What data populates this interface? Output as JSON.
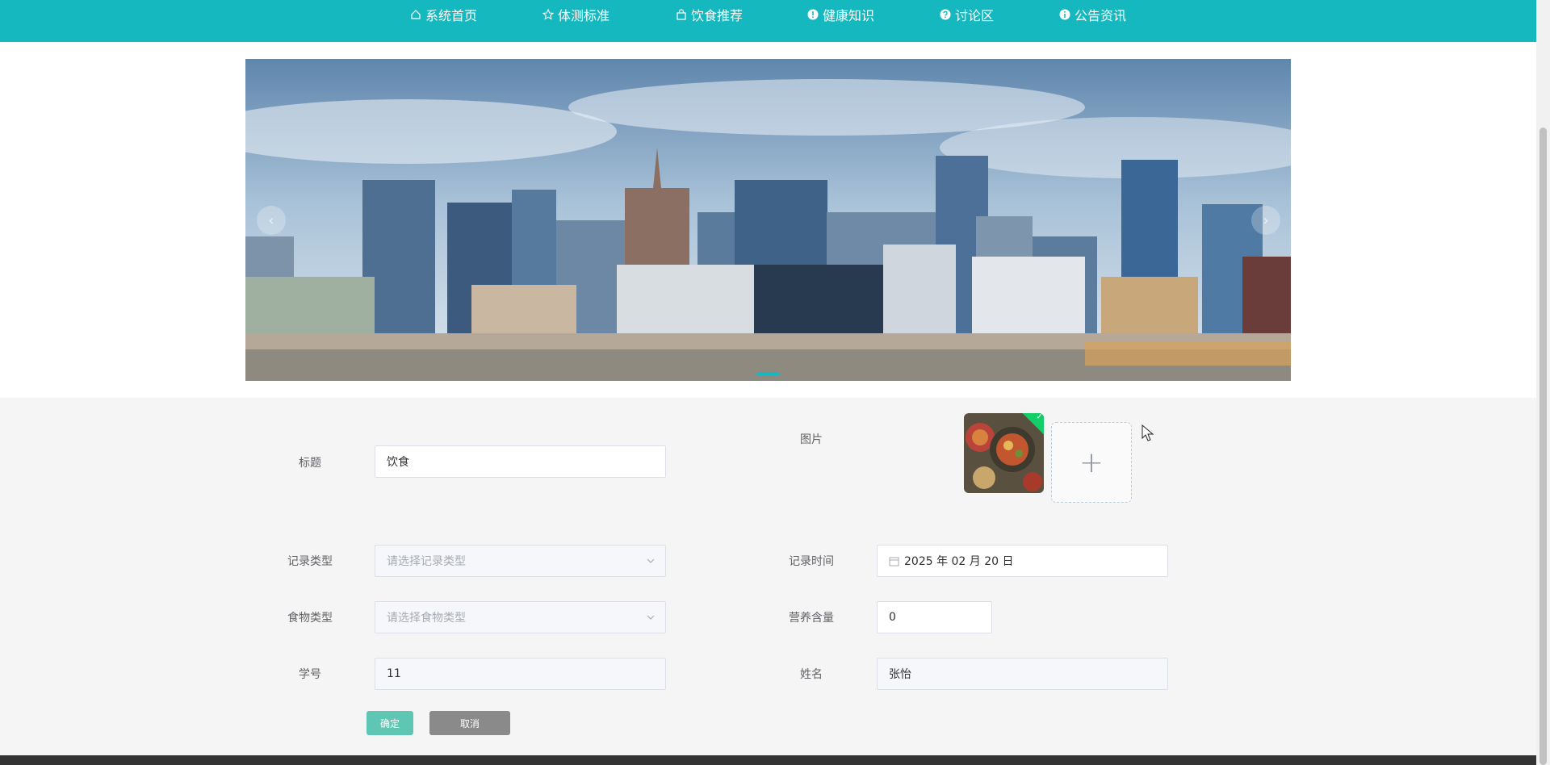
{
  "nav": {
    "items": [
      {
        "label": "系统首页",
        "icon": "home-icon"
      },
      {
        "label": "体测标准",
        "icon": "star-icon"
      },
      {
        "label": "饮食推荐",
        "icon": "bag-icon"
      },
      {
        "label": "健康知识",
        "icon": "info-circle-icon"
      },
      {
        "label": "讨论区",
        "icon": "question-circle-icon"
      },
      {
        "label": "公告资讯",
        "icon": "info-circle-icon"
      }
    ]
  },
  "banner": {
    "prev_label": "‹",
    "next_label": "›"
  },
  "form": {
    "title": {
      "label": "标题",
      "value": "饮食"
    },
    "image": {
      "label": "图片",
      "upload_label": "+"
    },
    "record_type": {
      "label": "记录类型",
      "placeholder": "请选择记录类型"
    },
    "record_time": {
      "label": "记录时间",
      "value": "2025 年 02 月 20 日"
    },
    "food_type": {
      "label": "食物类型",
      "placeholder": "请选择食物类型"
    },
    "nutrition": {
      "label": "营养含量",
      "value": "0"
    },
    "student_id": {
      "label": "学号",
      "value": "11"
    },
    "name": {
      "label": "姓名",
      "value": "张怡"
    },
    "confirm_label": "确定",
    "cancel_label": "取消"
  },
  "colors": {
    "nav": "#14b8be",
    "confirm": "#5fc6b4",
    "cancel": "#8a8a8a",
    "form_bg": "#f5f5f5"
  }
}
